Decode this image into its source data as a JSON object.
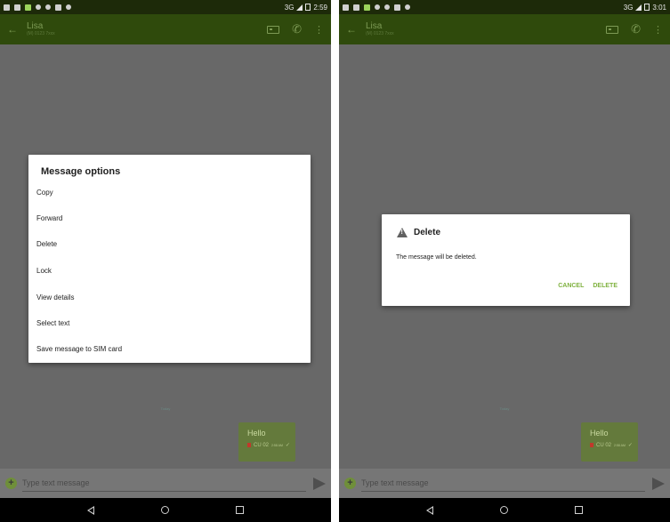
{
  "screens": [
    {
      "status_bar": {
        "network": "3G",
        "time": "2:59"
      },
      "toolbar": {
        "contact_name": "Lisa",
        "contact_sub": "(M) 0123 7xxx"
      },
      "conversation": {
        "date_divider": "Today",
        "message": {
          "text": "Hello",
          "meta": "CU 02",
          "time": "2:58 AM"
        }
      },
      "composer": {
        "placeholder": "Type text message"
      },
      "options_dialog": {
        "title": "Message options",
        "items": [
          "Copy",
          "Forward",
          "Delete",
          "Lock",
          "View details",
          "Select text",
          "Save message to SIM card"
        ]
      }
    },
    {
      "status_bar": {
        "network": "3G",
        "time": "3:01"
      },
      "toolbar": {
        "contact_name": "Lisa",
        "contact_sub": "(M) 0123 7xxx"
      },
      "conversation": {
        "date_divider": "Today",
        "message": {
          "text": "Hello",
          "meta": "CU 02",
          "time": "2:58 AM"
        }
      },
      "composer": {
        "placeholder": "Type text message"
      },
      "delete_dialog": {
        "title": "Delete",
        "message": "The message will be deleted.",
        "cancel_label": "CANCEL",
        "delete_label": "DELETE"
      }
    }
  ],
  "colors": {
    "status_bar": "#1d2a09",
    "toolbar": "#2f4a0c",
    "background_dimmed": "#686868",
    "accent": "#7fb13f",
    "bubble": "#647a3c"
  },
  "icons": [
    "back-arrow-icon",
    "contact-card-icon",
    "phone-call-icon",
    "more-vert-icon",
    "add-icon",
    "send-icon",
    "warning-icon",
    "nav-back-icon",
    "nav-home-icon",
    "nav-recents-icon"
  ]
}
